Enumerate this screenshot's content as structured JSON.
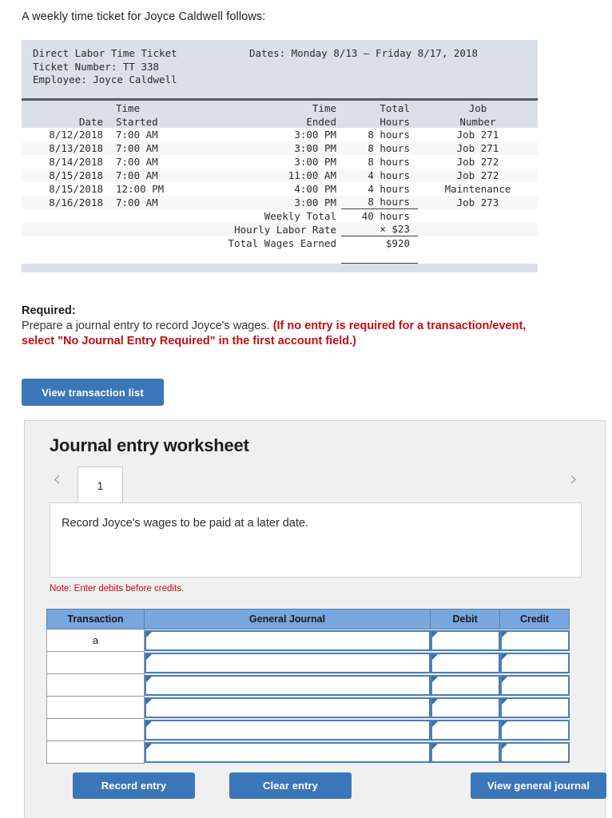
{
  "intro": "A weekly time ticket for Joyce Caldwell follows:",
  "ticket": {
    "title": "Direct Labor Time Ticket",
    "number_line": "Ticket Number: TT 338",
    "employee_line": "Employee: Joyce Caldwell",
    "dates_line": "Dates: Monday 8/13 – Friday 8/17, 2018",
    "columns": [
      {
        "top": "",
        "bottom": "Date"
      },
      {
        "top": "Time",
        "bottom": "Started"
      },
      {
        "top": "Time",
        "bottom": "Ended"
      },
      {
        "top": "Total",
        "bottom": "Hours"
      },
      {
        "top": "Job",
        "bottom": "Number"
      }
    ],
    "rows": [
      {
        "date": "8/12/2018",
        "started": "7:00 AM",
        "ended": "3:00 PM",
        "hours": "8 hours",
        "job": "Job 271"
      },
      {
        "date": "8/13/2018",
        "started": "7:00 AM",
        "ended": "3:00 PM",
        "hours": "8 hours",
        "job": "Job 271"
      },
      {
        "date": "8/14/2018",
        "started": "7:00 AM",
        "ended": "3:00 PM",
        "hours": "8 hours",
        "job": "Job 272"
      },
      {
        "date": "8/15/2018",
        "started": "7:00 AM",
        "ended": "11:00 AM",
        "hours": "4 hours",
        "job": "Job 272"
      },
      {
        "date": "8/15/2018",
        "started": "12:00 PM",
        "ended": "4:00 PM",
        "hours": "4 hours",
        "job": "Maintenance"
      },
      {
        "date": "8/16/2018",
        "started": "7:00 AM",
        "ended": "3:00 PM",
        "hours": "8 hours",
        "job": "Job 273"
      }
    ],
    "totals": [
      {
        "label": "Weekly Total",
        "value": "40 hours"
      },
      {
        "label": "Hourly Labor Rate",
        "value": "× $23"
      },
      {
        "label": "Total Wages Earned",
        "value": "$920"
      }
    ]
  },
  "required": {
    "title": "Required:",
    "sentence": "Prepare a journal entry to record Joyce's wages.",
    "hint_line1": "(If no entry is required for a transaction/event,",
    "hint_line2": "select \"No Journal Entry Required\" in the first account field.)"
  },
  "buttons": {
    "view_transaction_list": "View transaction list",
    "record_entry": "Record entry",
    "clear_entry": "Clear entry",
    "view_general_journal": "View general journal"
  },
  "worksheet": {
    "title": "Journal entry worksheet",
    "prev_icon": "chevron-left-icon",
    "next_icon": "chevron-right-icon",
    "tab_label": "1",
    "description": "Record Joyce's wages to be paid at a later date.",
    "note": "Note: Enter debits before credits.",
    "table": {
      "headers": [
        "Transaction",
        "General Journal",
        "Debit",
        "Credit"
      ],
      "rows": [
        {
          "transaction": "a",
          "general_journal": "",
          "debit": "",
          "credit": ""
        },
        {
          "transaction": "",
          "general_journal": "",
          "debit": "",
          "credit": ""
        },
        {
          "transaction": "",
          "general_journal": "",
          "debit": "",
          "credit": ""
        },
        {
          "transaction": "",
          "general_journal": "",
          "debit": "",
          "credit": ""
        },
        {
          "transaction": "",
          "general_journal": "",
          "debit": "",
          "credit": ""
        },
        {
          "transaction": "",
          "general_journal": "",
          "debit": "",
          "credit": ""
        }
      ]
    }
  },
  "colors": {
    "accent_blue": "#3b76b8",
    "table_header_blue": "#77a7dd",
    "red": "#c00d17",
    "ticket_header_bg": "#dbdfe8",
    "panel_bg": "#f0f0f0"
  }
}
